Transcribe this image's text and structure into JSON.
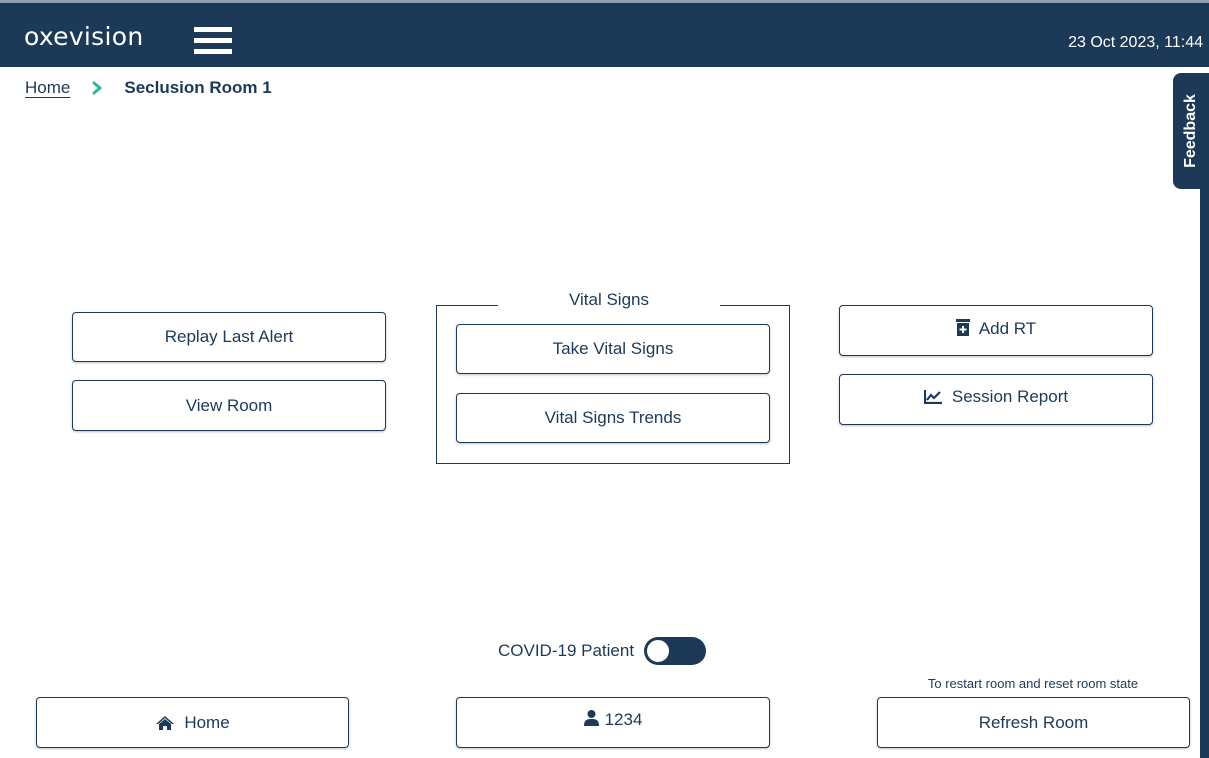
{
  "header": {
    "logo": "oxevision",
    "datetime": "23 Oct 2023, 11:44"
  },
  "breadcrumb": {
    "home": "Home",
    "current": "Seclusion Room 1"
  },
  "feedback": {
    "label": "Feedback"
  },
  "actions": {
    "replay_last_alert": "Replay Last Alert",
    "view_room": "View Room",
    "vital_signs_title": "Vital Signs",
    "take_vital_signs": "Take Vital Signs",
    "vital_signs_trends": "Vital Signs Trends",
    "add_rt": "Add RT",
    "session_report": "Session Report"
  },
  "covid": {
    "label": "COVID-19 Patient",
    "enabled": false
  },
  "footer": {
    "home": "Home",
    "patient_id": "1234",
    "refresh_hint": "To restart room and reset room state",
    "refresh_room": "Refresh Room"
  },
  "colors": {
    "primary": "#1c3a57",
    "accent": "#2db89a",
    "background": "#ffffff"
  },
  "icons": {
    "menu": "hamburger-icon",
    "breadcrumb_separator": "chevron-right-icon",
    "add_rt": "medication-icon",
    "session_report": "chart-line-icon",
    "home": "home-icon",
    "patient": "user-icon"
  }
}
